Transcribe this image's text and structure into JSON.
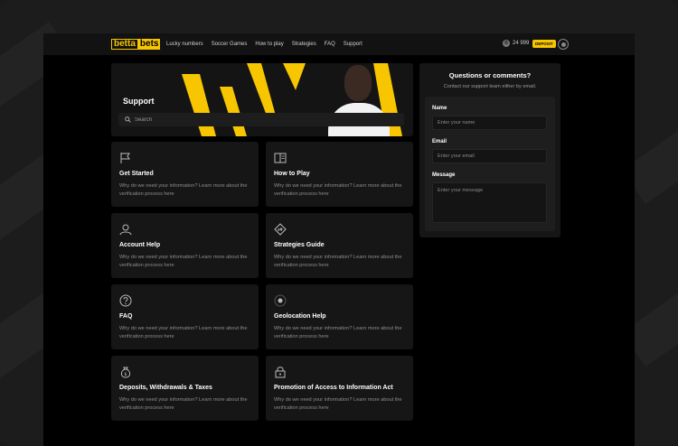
{
  "header": {
    "logo_part1": "betta",
    "logo_part2": "bets",
    "nav": [
      "Lucky numbers",
      "Soccer Games",
      "How to play",
      "Strategies",
      "FAQ",
      "Support"
    ],
    "balance": "24 999",
    "coin_symbol": "B",
    "deposit_label": "DEPOSIT"
  },
  "hero": {
    "title": "Support",
    "search_placeholder": "Search"
  },
  "cards": [
    {
      "title": "Get Started",
      "desc": "Why do we need your information? Learn more about the verification process here",
      "icon": "flag-icon"
    },
    {
      "title": "How to Play",
      "desc": "Why do we need your information? Learn more about the verification process here",
      "icon": "book-icon"
    },
    {
      "title": "Account Help",
      "desc": "Why do we need your information? Learn more about the verification process here",
      "icon": "user-icon"
    },
    {
      "title": "Strategies Guide",
      "desc": "Why do we need your information? Learn more about the verification process here",
      "icon": "directions-icon"
    },
    {
      "title": "FAQ",
      "desc": "Why do we need your information? Learn more about the verification process here",
      "icon": "question-icon"
    },
    {
      "title": "Geolocation Help",
      "desc": "Why do we need your information? Learn more about the verification process here",
      "icon": "location-icon"
    },
    {
      "title": "Deposits, Withdrawals & Taxes",
      "desc": "Why do we need your information? Learn more about the verification process here",
      "icon": "money-bag-icon"
    },
    {
      "title": "Promotion of Access to Information Act",
      "desc": "Why do we need your information? Learn more about the verification process here",
      "icon": "lock-icon"
    }
  ],
  "contact": {
    "title": "Questions or comments?",
    "subtitle": "Contact our support team either by email.",
    "name_label": "Name",
    "name_placeholder": "Enter your name",
    "email_label": "Email",
    "email_placeholder": "Enter your email",
    "message_label": "Message",
    "message_placeholder": "Enter your message"
  },
  "colors": {
    "accent": "#f7c600",
    "background": "#000000",
    "card": "#161616"
  }
}
